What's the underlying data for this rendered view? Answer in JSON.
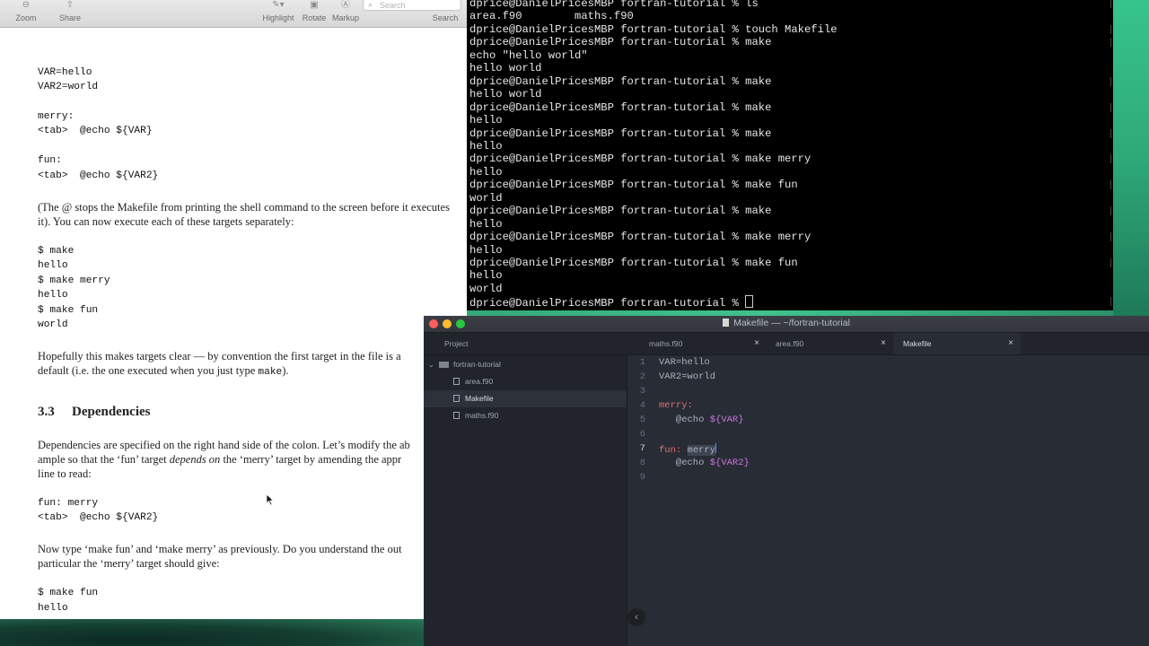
{
  "preview": {
    "toolbar": {
      "zoom": "Zoom",
      "share": "Share",
      "highlight": "Highlight",
      "rotate": "Rotate",
      "markup": "Markup",
      "search_label": "Search",
      "search_placeholder": "Search"
    },
    "doc": {
      "code1": [
        "VAR=hello",
        "VAR2=world"
      ],
      "code2": [
        "merry:",
        "<tab>  @echo ${VAR}"
      ],
      "code3": [
        "fun:",
        "<tab>  @echo ${VAR2}"
      ],
      "para1a": "(The @ stops the Makefile from printing the shell command to the screen before it executes",
      "para1b": "it). You can now execute each of these targets separately:",
      "code4": [
        "$ make",
        "hello",
        "$ make merry",
        "hello",
        "$ make fun",
        "world"
      ],
      "para2a": "Hopefully this makes targets clear — by convention the first target in the file is a",
      "para2b_pre": "default (i.e. the one executed when you just type ",
      "para2b_code": "make",
      "para2b_post": ").",
      "section_num": "3.3",
      "section_title": "Dependencies",
      "para3a": "Dependencies are specified on the right hand side of the colon. Let’s modify the ab",
      "para3b_pre": "ample so that the ‘fun’ target ",
      "para3b_em": "depends on",
      "para3b_post": " the ‘merry’ target by amending the appr",
      "para3c": "line to read:",
      "code5": [
        "fun: merry",
        "<tab>  @echo ${VAR2}"
      ],
      "para4a": "Now type ‘make fun’ and ‘make merry’ as previously. Do you understand the out",
      "para4b": "particular the ‘merry’ target should give:",
      "code6": [
        "$ make fun",
        "hello"
      ]
    }
  },
  "terminal": {
    "lines": [
      "dprice@DanielPricesMBP fortran-tutorial % ls",
      "area.f90        maths.f90",
      "dprice@DanielPricesMBP fortran-tutorial % touch Makefile",
      "dprice@DanielPricesMBP fortran-tutorial % make",
      "echo \"hello world\"",
      "hello world",
      "dprice@DanielPricesMBP fortran-tutorial % make",
      "hello world",
      "dprice@DanielPricesMBP fortran-tutorial % make",
      "hello",
      "dprice@DanielPricesMBP fortran-tutorial % make",
      "hello",
      "dprice@DanielPricesMBP fortran-tutorial % make merry",
      "hello",
      "dprice@DanielPricesMBP fortran-tutorial % make fun",
      "world",
      "dprice@DanielPricesMBP fortran-tutorial % make",
      "hello",
      "dprice@DanielPricesMBP fortran-tutorial % make merry",
      "hello",
      "dprice@DanielPricesMBP fortran-tutorial % make fun",
      "hello",
      "world",
      "dprice@DanielPricesMBP fortran-tutorial % "
    ]
  },
  "editor": {
    "window_title": "Makefile — ~/fortran-tutorial",
    "tabs": [
      {
        "label": "maths.f90"
      },
      {
        "label": "area.f90"
      },
      {
        "label": "Makefile"
      }
    ],
    "tree": {
      "header": "Project",
      "root": "fortran-tutorial",
      "files": [
        "area.f90",
        "Makefile",
        "maths.f90"
      ]
    },
    "gutter": [
      "1",
      "2",
      "3",
      "4",
      "5",
      "6",
      "7",
      "8",
      "9"
    ],
    "code": {
      "l1": "VAR=hello",
      "l2": "VAR2=world",
      "l4": "merry:",
      "l5_pre": "   @echo ",
      "l5_var": "${VAR}",
      "l7_pre": "fun: ",
      "l7_sel": "merry",
      "l8_pre": "   @echo ",
      "l8_var": "${VAR2}"
    }
  },
  "colors": {
    "traffic_close": "#ff5f57",
    "traffic_min": "#febc2e",
    "traffic_max": "#28c840"
  }
}
